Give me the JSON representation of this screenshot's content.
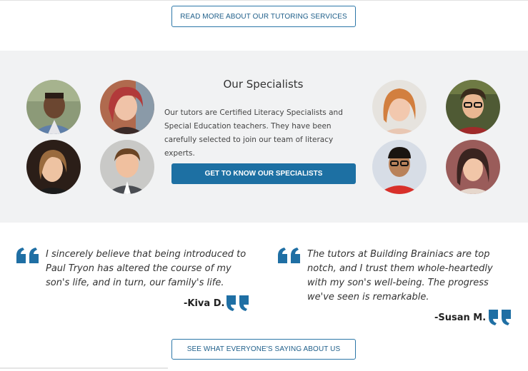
{
  "top_button": {
    "label": "READ MORE ABOUT OUR TUTORING SERVICES"
  },
  "specialists": {
    "heading": "Our Specialists",
    "description": "Our tutors are Certified Literacy Specialists and Special Education teachers. They have been carefully selected to join our team of literacy experts.",
    "button_label": "GET TO KNOW OUR SPECIALISTS"
  },
  "testimonials": [
    {
      "text": "I sincerely believe that being introduced to Paul Tryon has altered the course of my son's life, and in turn, our family's life.",
      "author": "-Kiva D."
    },
    {
      "text": "The tutors at Building Brainiacs are top notch, and I trust them whole-heartedly with my son's well-being. The progress we've seen is remarkable.",
      "author": "-Susan M."
    }
  ],
  "bottom_button": {
    "label": "SEE WHAT EVERYONE'S SAYING ABOUT US"
  },
  "colors": {
    "accent": "#1d70a3",
    "quote_mark": "#1f6fa4",
    "band": "#f1f2f3"
  }
}
